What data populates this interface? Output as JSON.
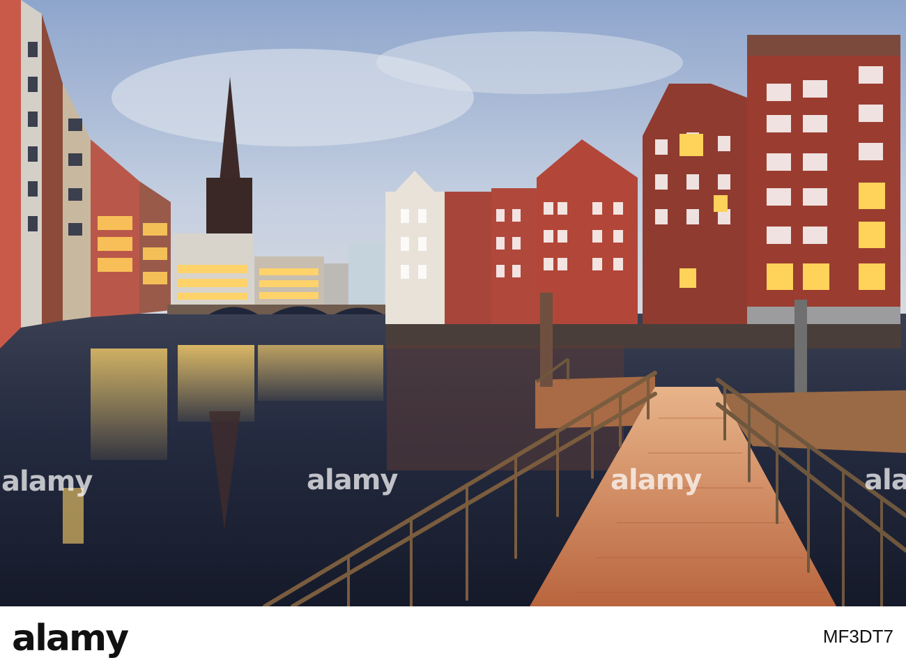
{
  "watermark": {
    "text": "alamy",
    "instances": 4
  },
  "footer": {
    "brand": "alamy",
    "image_id": "MF3DT7"
  },
  "colors": {
    "sky_top": "#8fa6cc",
    "sky_bottom": "#c9d3e3",
    "water": "#1c2235",
    "brick": "#9a3a2c",
    "walkway": "#d9895a",
    "railing": "#7a5a3a"
  }
}
